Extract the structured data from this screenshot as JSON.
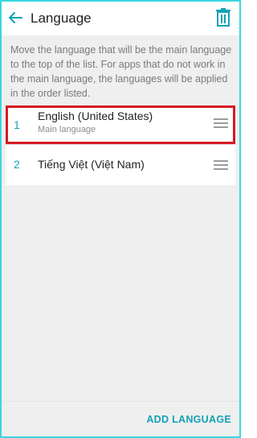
{
  "header": {
    "title": "Language",
    "back_icon": "arrow-left-icon",
    "delete_icon": "trash-icon"
  },
  "description": "Move the language that will be the main language to the top of the list. For apps that do not work in the main language, the languages will be applied in the order listed.",
  "languages": [
    {
      "index": "1",
      "name": "English (United States)",
      "subtitle": "Main language",
      "highlighted": true
    },
    {
      "index": "2",
      "name": "Tiếng Việt (Việt Nam)",
      "subtitle": "",
      "highlighted": false
    }
  ],
  "footer": {
    "add_language_label": "ADD LANGUAGE"
  },
  "colors": {
    "accent": "#11a3b6",
    "frame_border": "#3ad6df",
    "highlight_border": "#d61a23",
    "background": "#efefef"
  }
}
